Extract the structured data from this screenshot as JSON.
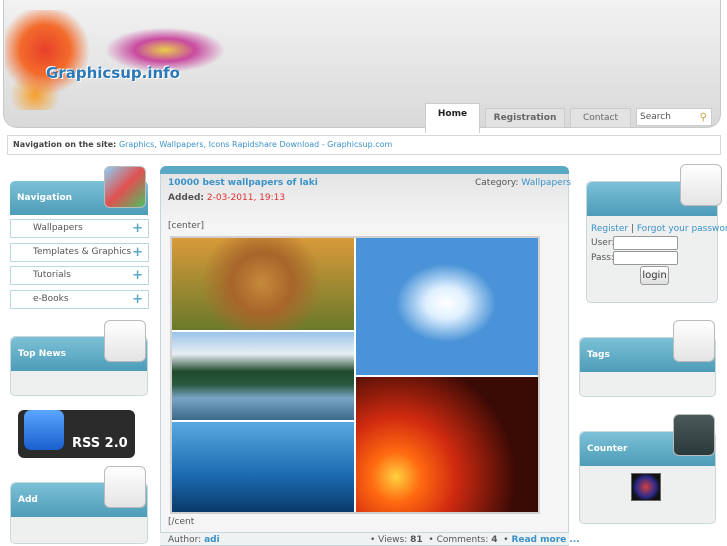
{
  "header": {
    "logo": "Graphicsup.info",
    "tabs": [
      "Home",
      "Registration",
      "Contact"
    ],
    "search_placeholder": "Search"
  },
  "navbar": {
    "label": "Navigation on the site:",
    "text": "Graphics, Wallpapers, Icons Rapidshare Download - Graphicsup.com"
  },
  "left": {
    "navigation_title": "Navigation",
    "menu": [
      "Wallpapers",
      "Templates & Graphics",
      "Tutorials",
      "e-Books"
    ],
    "top_news_title": "Top News",
    "rss_label": "RSS 2.0",
    "add_title": "Add"
  },
  "post": {
    "title": "10000 best wallpapers of laki",
    "category_label": "Category:",
    "category": "Wallpapers",
    "added_label": "Added:",
    "added": "2-03-2011, 19:13",
    "body_start": "[center]",
    "body_end": "[/cent",
    "author_label": "Author:",
    "author": "adi",
    "views_label": "Views:",
    "views": "81",
    "comments_label": "Comments:",
    "comments": "4",
    "read_more": "Read more ..."
  },
  "right": {
    "register": "Register",
    "forgot": "Forgot your password?",
    "user_label": "User:",
    "pass_label": "Pass:",
    "login": "login",
    "tags_title": "Tags",
    "counter_title": "Counter"
  }
}
